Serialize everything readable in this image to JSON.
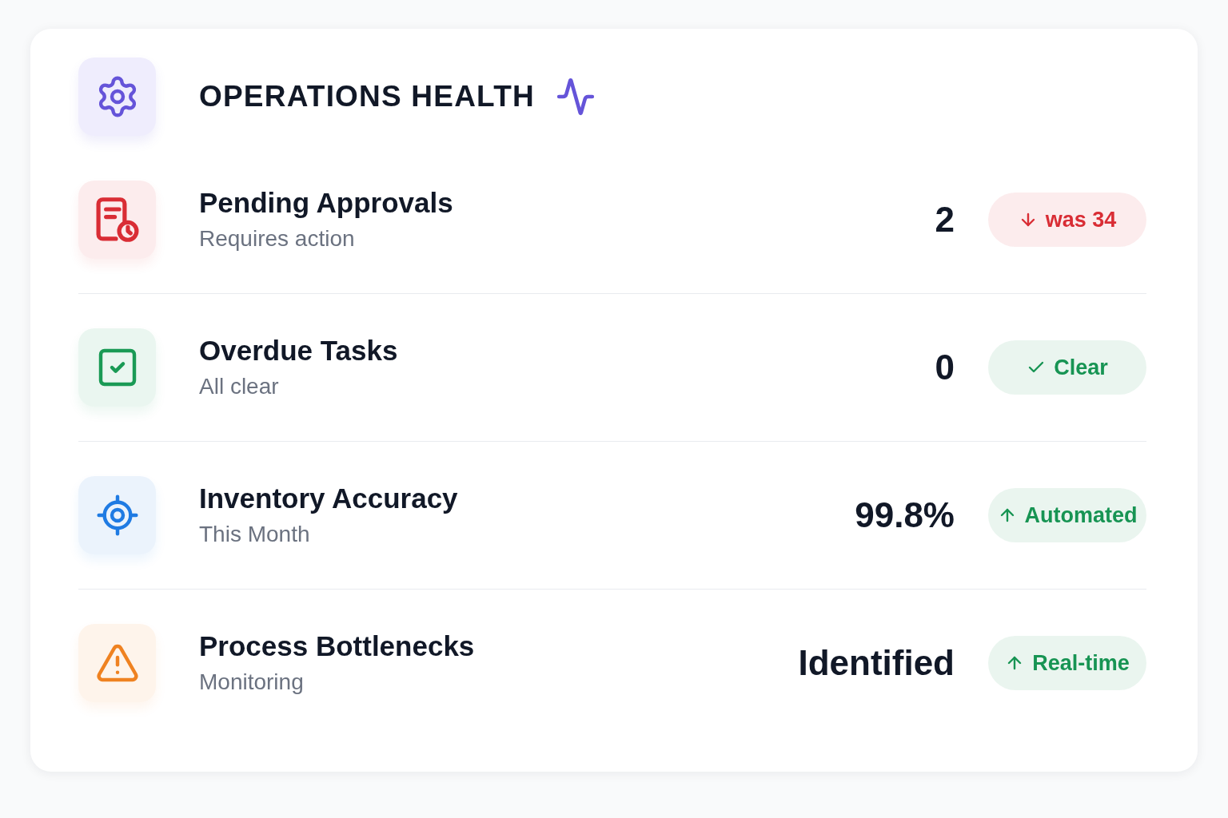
{
  "header": {
    "title": "OPERATIONS HEALTH"
  },
  "rows": [
    {
      "kind": "approvals",
      "color": "#d92d35",
      "title": "Pending Approvals",
      "subtitle": "Requires action",
      "value": "2",
      "badge": {
        "kind": "down",
        "color": "#d92d35",
        "label": "was 34"
      }
    },
    {
      "kind": "tasks",
      "color": "#1a9a55",
      "title": "Overdue Tasks",
      "subtitle": "All clear",
      "value": "0",
      "badge": {
        "kind": "check",
        "color": "#179453",
        "label": "Clear"
      }
    },
    {
      "kind": "accuracy",
      "color": "#1f7be3",
      "title": "Inventory Accuracy",
      "subtitle": "This Month",
      "value": "99.8%",
      "badge": {
        "kind": "up",
        "color": "#179453",
        "label": "Automated"
      }
    },
    {
      "kind": "bottlenecks",
      "color": "#ef8221",
      "title": "Process Bottlenecks",
      "subtitle": "Monitoring",
      "value": "Identified",
      "badge": {
        "kind": "up",
        "color": "#179453",
        "label": "Real-time"
      }
    }
  ]
}
